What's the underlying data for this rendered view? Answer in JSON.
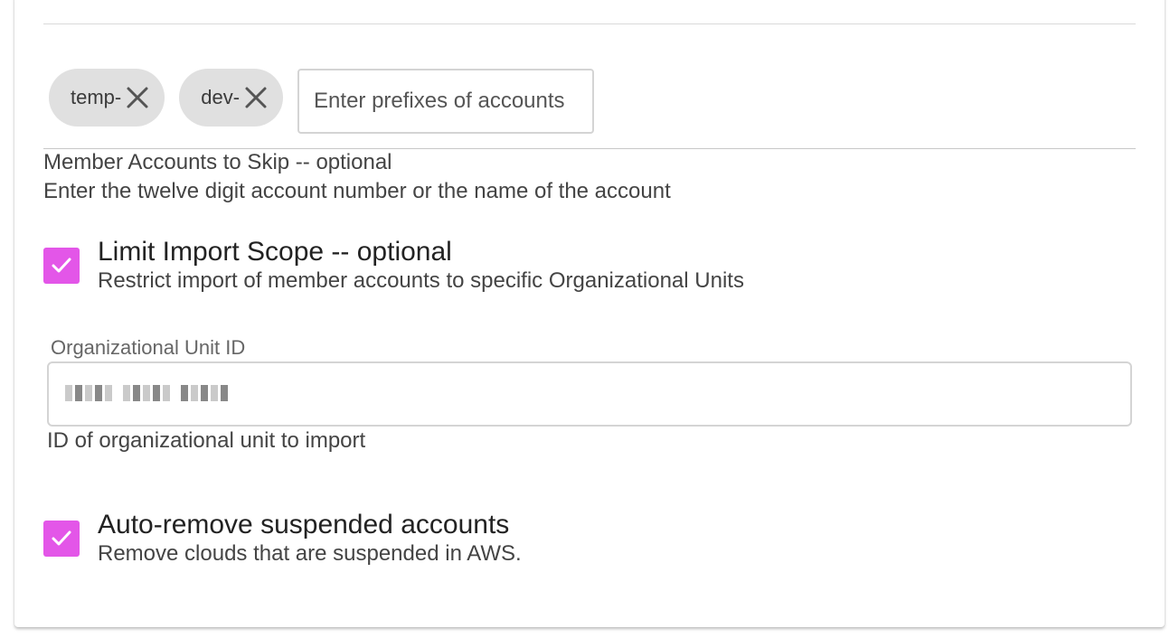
{
  "prefixes": {
    "chips": [
      {
        "label": "temp-"
      },
      {
        "label": "dev-"
      }
    ],
    "input_placeholder": "Enter prefixes of accounts",
    "input_value": ""
  },
  "skip_accounts": {
    "label": "Member Accounts to Skip -- optional",
    "help": "Enter the twelve digit account number or the name of the account"
  },
  "limit_scope": {
    "checked": true,
    "title": "Limit Import Scope -- optional",
    "description": "Restrict import of member accounts to specific Organizational Units"
  },
  "ou_field": {
    "label": "Organizational Unit ID",
    "value_redacted": true,
    "help": "ID of organizational unit to import"
  },
  "auto_remove": {
    "checked": true,
    "title": "Auto-remove suspended accounts",
    "description": "Remove clouds that are suspended in AWS."
  },
  "colors": {
    "checkbox": "#e356e8",
    "chip_bg": "#e0e0e0"
  },
  "icons": {
    "chip_remove": "close-icon",
    "checkbox_mark": "checkmark-icon"
  }
}
